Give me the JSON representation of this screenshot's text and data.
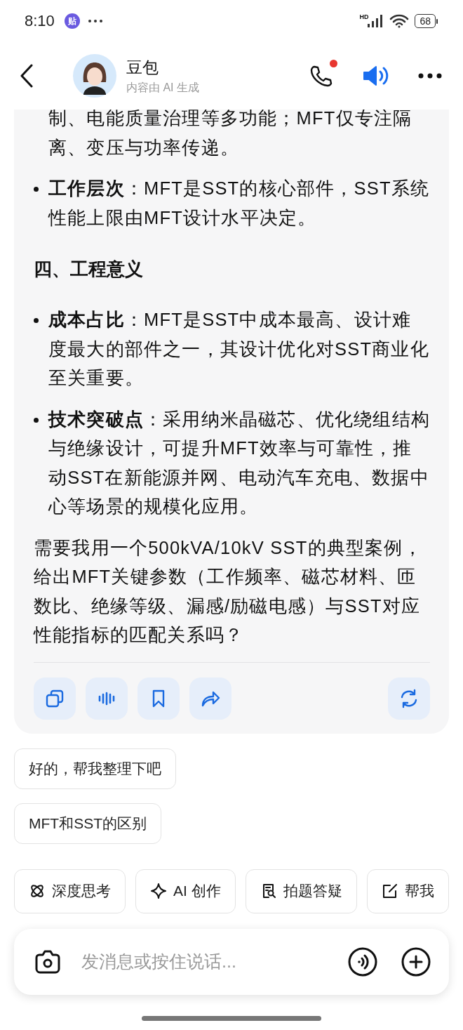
{
  "status_bar": {
    "time": "8:10",
    "app_badge": "贴",
    "network": "HD",
    "battery": "68"
  },
  "header": {
    "title": "豆包",
    "subtitle": "内容由 AI 生成",
    "call_notification": true,
    "speaker_on": true
  },
  "message": {
    "blocks": [
      {
        "kind": "continuation",
        "text": "制、电能质量治理等多功能；MFT仅专注隔离、变压与功率传递。"
      },
      {
        "kind": "bullet",
        "text": "**工作层次**：MFT是SST的核心部件，SST系统性能上限由MFT设计水平决定。"
      },
      {
        "kind": "heading",
        "text": "四、工程意义"
      },
      {
        "kind": "bullet",
        "text": "**成本占比**：MFT是SST中成本最高、设计难度最大的部件之一，其设计优化对SST商业化至关重要。"
      },
      {
        "kind": "bullet",
        "text": "**技术突破点**：采用纳米晶磁芯、优化绕组结构与绝缘设计，可提升MFT效率与可靠性，推动SST在新能源并网、电动汽车充电、数据中心等场景的规模化应用。"
      },
      {
        "kind": "paragraph",
        "text": "需要我用一个500kVA/10kV SST的典型案例，给出MFT关键参数（工作频率、磁芯材料、匝数比、绝缘等级、漏感/励磁电感）与SST对应性能指标的匹配关系吗？"
      }
    ]
  },
  "suggestions": [
    "好的，帮我整理下吧",
    "MFT和SST的区别"
  ],
  "tools": [
    {
      "kind": "deep_think",
      "label": "深度思考"
    },
    {
      "kind": "ai_create",
      "label": "AI 创作"
    },
    {
      "kind": "photo_answer",
      "label": "拍题答疑"
    },
    {
      "kind": "write",
      "label": "帮我"
    }
  ],
  "composer": {
    "placeholder": "发消息或按住说话..."
  }
}
